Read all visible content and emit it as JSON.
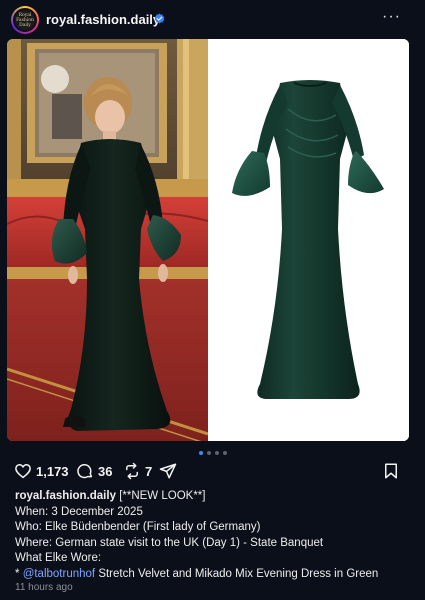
{
  "header": {
    "username": "royal.fashion.daily",
    "avatar_text": "Royal Fashion Daily",
    "more_label": "···"
  },
  "carousel": {
    "count": 4,
    "active_index": 0
  },
  "actions": {
    "likes": "1,173",
    "comments": "36",
    "reposts": "7"
  },
  "caption": {
    "username": "royal.fashion.daily",
    "tag": "[**NEW LOOK**]",
    "when": "When: 3 December 2025",
    "who": "Who: Elke Büdenbender (First lady of Germany)",
    "where": "Where: German state visit to the UK (Day 1) - State Banquet",
    "what_heading": "What Elke Wore:",
    "bullet": "*",
    "mention": "@talbotrunhof",
    "item": "Stretch Velvet and Mikado Mix Evening Dress in Green"
  },
  "timestamp": "11 hours ago",
  "colors": {
    "background": "#0b0f19",
    "verified": "#3b82f6",
    "mention": "#7ea6ff",
    "dress": "#123a2f"
  }
}
